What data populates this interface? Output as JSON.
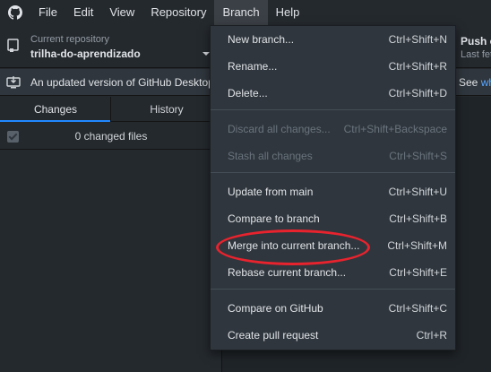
{
  "menubar": {
    "icon": "github-icon",
    "items": [
      "File",
      "Edit",
      "View",
      "Repository",
      "Branch",
      "Help"
    ]
  },
  "toolbar": {
    "repo_label": "Current repository",
    "repo_name": "trilha-do-aprendizado",
    "push_title": "Push o",
    "push_sub": "Last fet"
  },
  "banner": {
    "text": "An updated version of GitHub Desktop",
    "right_text": "See",
    "right_link": "wh"
  },
  "tabs": [
    "Changes",
    "History"
  ],
  "changes": {
    "summary": "0 changed files"
  },
  "branch_menu": {
    "items": [
      {
        "label": "New branch...",
        "shortcut": "Ctrl+Shift+N",
        "disabled": false
      },
      {
        "label": "Rename...",
        "shortcut": "Ctrl+Shift+R",
        "disabled": false
      },
      {
        "label": "Delete...",
        "shortcut": "Ctrl+Shift+D",
        "disabled": false
      },
      {
        "label": "Discard all changes...",
        "shortcut": "Ctrl+Shift+Backspace",
        "disabled": true
      },
      {
        "label": "Stash all changes",
        "shortcut": "Ctrl+Shift+S",
        "disabled": true
      },
      {
        "label": "Update from main",
        "shortcut": "Ctrl+Shift+U",
        "disabled": false
      },
      {
        "label": "Compare to branch",
        "shortcut": "Ctrl+Shift+B",
        "disabled": false
      },
      {
        "label": "Merge into current branch...",
        "shortcut": "Ctrl+Shift+M",
        "disabled": false
      },
      {
        "label": "Rebase current branch...",
        "shortcut": "Ctrl+Shift+E",
        "disabled": false
      },
      {
        "label": "Compare on GitHub",
        "shortcut": "Ctrl+Shift+C",
        "disabled": false
      },
      {
        "label": "Create pull request",
        "shortcut": "Ctrl+R",
        "disabled": false
      }
    ]
  },
  "colors": {
    "annotation": "#e8232e",
    "accent": "#2188ff",
    "link": "#58a6ff"
  }
}
